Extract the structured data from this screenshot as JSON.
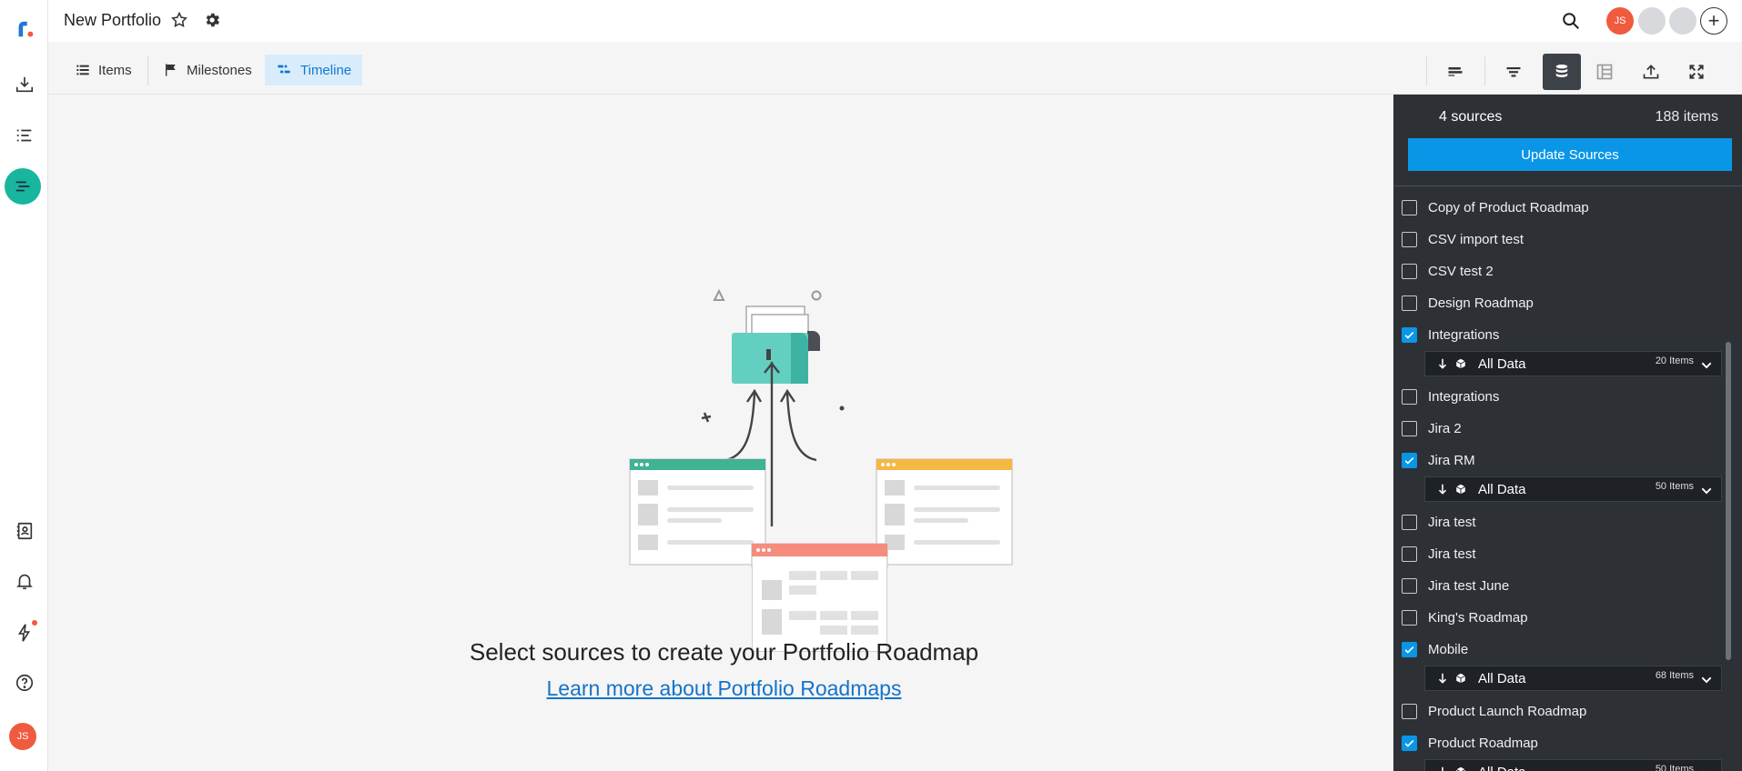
{
  "app": {
    "title": "New Portfolio",
    "user_initials": "JS",
    "brand_color": "#18b59f"
  },
  "header": {
    "add_symbol": "+"
  },
  "tabs": [
    {
      "label": "Items",
      "icon": "list-icon"
    },
    {
      "label": "Milestones",
      "icon": "flag-icon"
    },
    {
      "label": "Timeline",
      "icon": "timeline-icon",
      "active": true
    }
  ],
  "main": {
    "headline": "Select sources to create your Portfolio Roadmap",
    "link": "Learn more about Portfolio Roadmaps"
  },
  "panel": {
    "sources_count": "4 sources",
    "items_count": "188 items",
    "update_button": "Update Sources",
    "sources": [
      {
        "label": "Copy of Product Roadmap",
        "checked": false
      },
      {
        "label": "CSV import test",
        "checked": false
      },
      {
        "label": "CSV test 2",
        "checked": false
      },
      {
        "label": "Design Roadmap",
        "checked": false
      },
      {
        "label": "Integrations",
        "checked": true,
        "filter": "All Data",
        "count": "20 Items"
      },
      {
        "label": "Integrations",
        "checked": false
      },
      {
        "label": "Jira 2",
        "checked": false
      },
      {
        "label": "Jira RM",
        "checked": true,
        "filter": "All Data",
        "count": "50 Items"
      },
      {
        "label": "Jira test",
        "checked": false
      },
      {
        "label": "Jira test",
        "checked": false
      },
      {
        "label": "Jira test June",
        "checked": false
      },
      {
        "label": "King's Roadmap",
        "checked": false
      },
      {
        "label": "Mobile",
        "checked": true,
        "filter": "All Data",
        "count": "68 Items"
      },
      {
        "label": "Product Launch Roadmap",
        "checked": false
      },
      {
        "label": "Product Roadmap",
        "checked": true,
        "filter": "All Data",
        "count": "50 Items"
      }
    ]
  }
}
